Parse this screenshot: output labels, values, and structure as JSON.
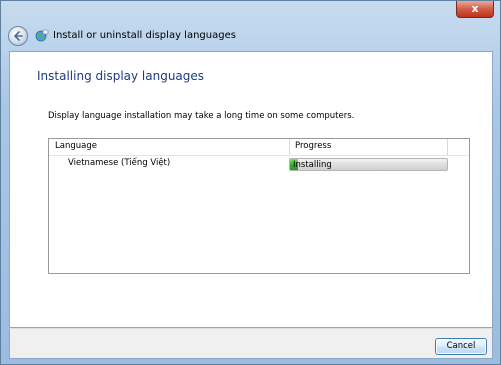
{
  "window": {
    "title": "Install or uninstall display languages",
    "close_glyph": "x"
  },
  "page": {
    "heading": "Installing display languages",
    "description": "Display language installation may take a long time on some computers."
  },
  "table": {
    "columns": [
      "Language",
      "Progress"
    ],
    "rows": [
      {
        "language": "Vietnamese (Tiếng Việt)",
        "status": "Installing",
        "progress_fraction": 0.05
      }
    ]
  },
  "footer": {
    "cancel_label": "Cancel"
  },
  "icons": {
    "back": "back-arrow-icon",
    "app": "language-globe-icon",
    "close": "close-icon"
  },
  "colors": {
    "heading": "#1e3b80",
    "progress_green": "#2fb52a",
    "close_red": "#c0321c"
  }
}
